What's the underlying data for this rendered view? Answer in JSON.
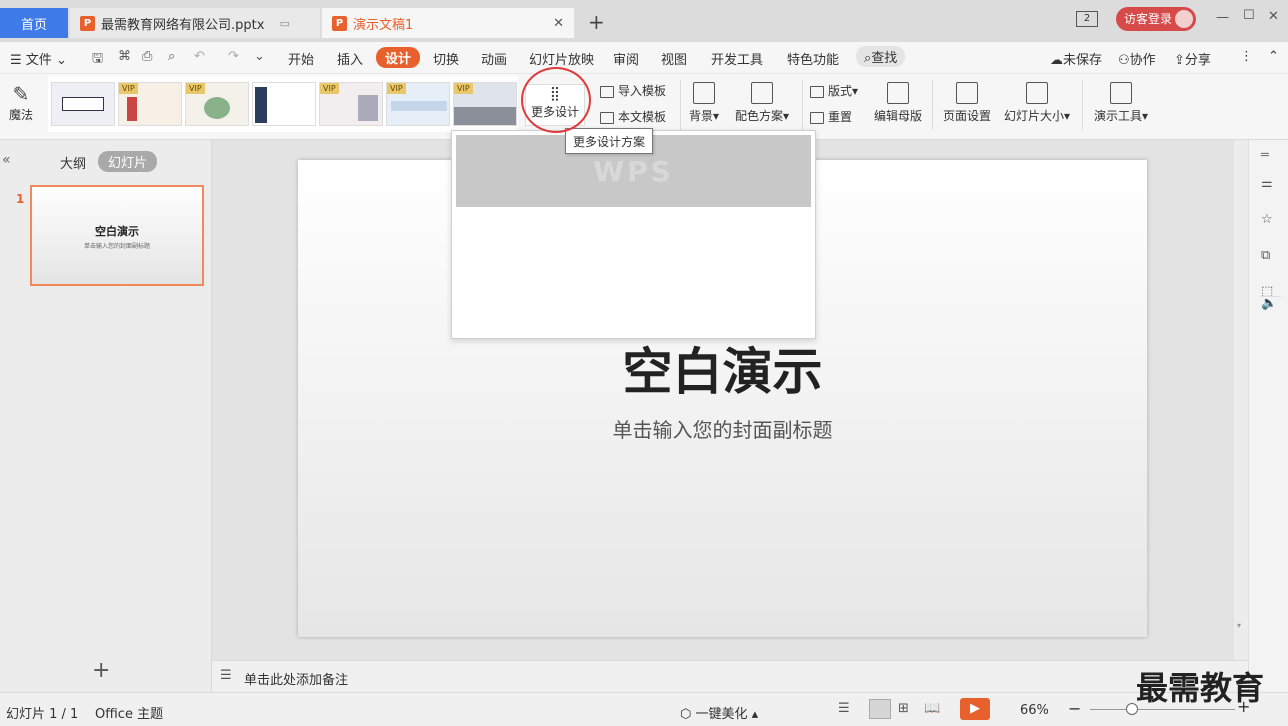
{
  "tabs": {
    "home": "首页",
    "file": "最需教育网络有限公司.pptx",
    "active": "演示文稿1",
    "new_tab": "+"
  },
  "titlebar": {
    "window_count": "2",
    "login": "访客登录",
    "minimize": "—",
    "maximize": "☐",
    "close": "✕"
  },
  "menu": {
    "file": "文件",
    "items": [
      "开始",
      "插入",
      "设计",
      "切换",
      "动画",
      "幻灯片放映",
      "审阅",
      "视图",
      "开发工具",
      "特色功能"
    ],
    "search": "查找",
    "unsaved": "未保存",
    "collab": "协作",
    "share": "分享"
  },
  "ribbon": {
    "magic": "魔法",
    "vip": "VIP",
    "more_design": "更多设计",
    "import_template": "导入模板",
    "this_template": "本文模板",
    "background": "背景",
    "color_scheme": "配色方案",
    "layout": "版式",
    "reset": "重置",
    "edit_master": "编辑母版",
    "page_setup": "页面设置",
    "slide_size": "幻灯片大小",
    "presentation_tools": "演示工具"
  },
  "tooltip": "更多设计方案",
  "popup": {
    "watermark": "WPS"
  },
  "leftpane": {
    "outline_tab": "大纲",
    "slides_tab": "幻灯片",
    "slide_number": "1",
    "thumb_title": "空白演示",
    "thumb_subtitle": "单击输入您的封面副标题",
    "add": "+"
  },
  "slide": {
    "title": "空白演示",
    "subtitle": "单击输入您的封面副标题"
  },
  "notes": {
    "placeholder": "单击此处添加备注"
  },
  "status": {
    "slide_count": "幻灯片 1 / 1",
    "theme": "Office 主题",
    "beautify": "一键美化",
    "zoom": "66%",
    "watermark_brand": "最需教育"
  },
  "colors": {
    "accent": "#e8612c",
    "home_tab": "#3e7ae8",
    "circle": "#e23b3b"
  }
}
